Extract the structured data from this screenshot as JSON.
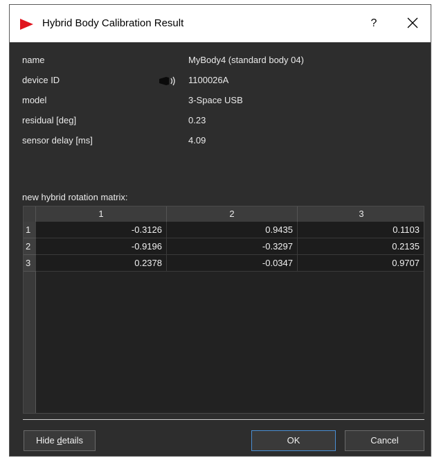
{
  "window": {
    "title": "Hybrid Body Calibration Result",
    "help_label": "?",
    "accent_color": "#e0141e"
  },
  "properties": [
    {
      "label": "name",
      "value": "MyBody4 (standard body 04)"
    },
    {
      "label": "device ID",
      "value": "1100026A",
      "icon": "wireless-sensor-icon"
    },
    {
      "label": "model",
      "value": "3-Space USB"
    },
    {
      "label": "residual [deg]",
      "value": "0.23"
    },
    {
      "label": "sensor delay [ms]",
      "value": "4.09"
    }
  ],
  "matrix": {
    "label": "new hybrid rotation matrix:",
    "columns": [
      "1",
      "2",
      "3"
    ],
    "row_headers": [
      "1",
      "2",
      "3"
    ],
    "rows": [
      [
        "-0.3126",
        "0.9435",
        "0.1103"
      ],
      [
        "-0.9196",
        "-0.3297",
        "0.2135"
      ],
      [
        "0.2378",
        "-0.0347",
        "0.9707"
      ]
    ]
  },
  "buttons": {
    "hide_details_pre": "Hide ",
    "hide_details_mnemonic": "d",
    "hide_details_post": "etails",
    "ok": "OK",
    "cancel": "Cancel"
  }
}
